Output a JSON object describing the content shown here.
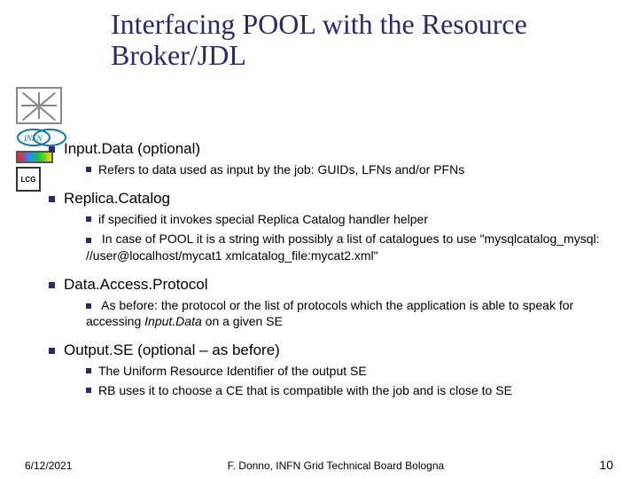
{
  "title": "Interfacing POOL with the Resource Broker/JDL",
  "logos": {
    "lcg": "LCG"
  },
  "sections": {
    "inputdata": {
      "heading": "Input.Data (optional)",
      "sub1": "Refers to data used as input by the job: GUIDs, LFNs and/or PFNs"
    },
    "replica": {
      "heading": "Replica.Catalog",
      "sub1": "if specified it invokes special Replica Catalog handler helper",
      "sub2": "In case of POOL it is a string with possibly a list of catalogues to use \"mysqlcatalog_mysql: //user@localhost/mycat1 xmlcatalog_file:mycat2.xml\""
    },
    "dap": {
      "heading": "Data.Access.Protocol",
      "sub1_a": "As before: the protocol or the list of protocols which the application is able to speak for accessing ",
      "sub1_b": "Input.Data",
      "sub1_c": " on a given SE"
    },
    "outputse": {
      "heading": "Output.SE (optional – as before)",
      "sub1": "The Uniform Resource Identifier of the output SE",
      "sub2": "RB uses it to choose a CE that is compatible with the job and is close to  SE"
    }
  },
  "footer": {
    "date": "6/12/2021",
    "author": "F. Donno, INFN Grid Technical Board Bologna",
    "page": "10"
  }
}
